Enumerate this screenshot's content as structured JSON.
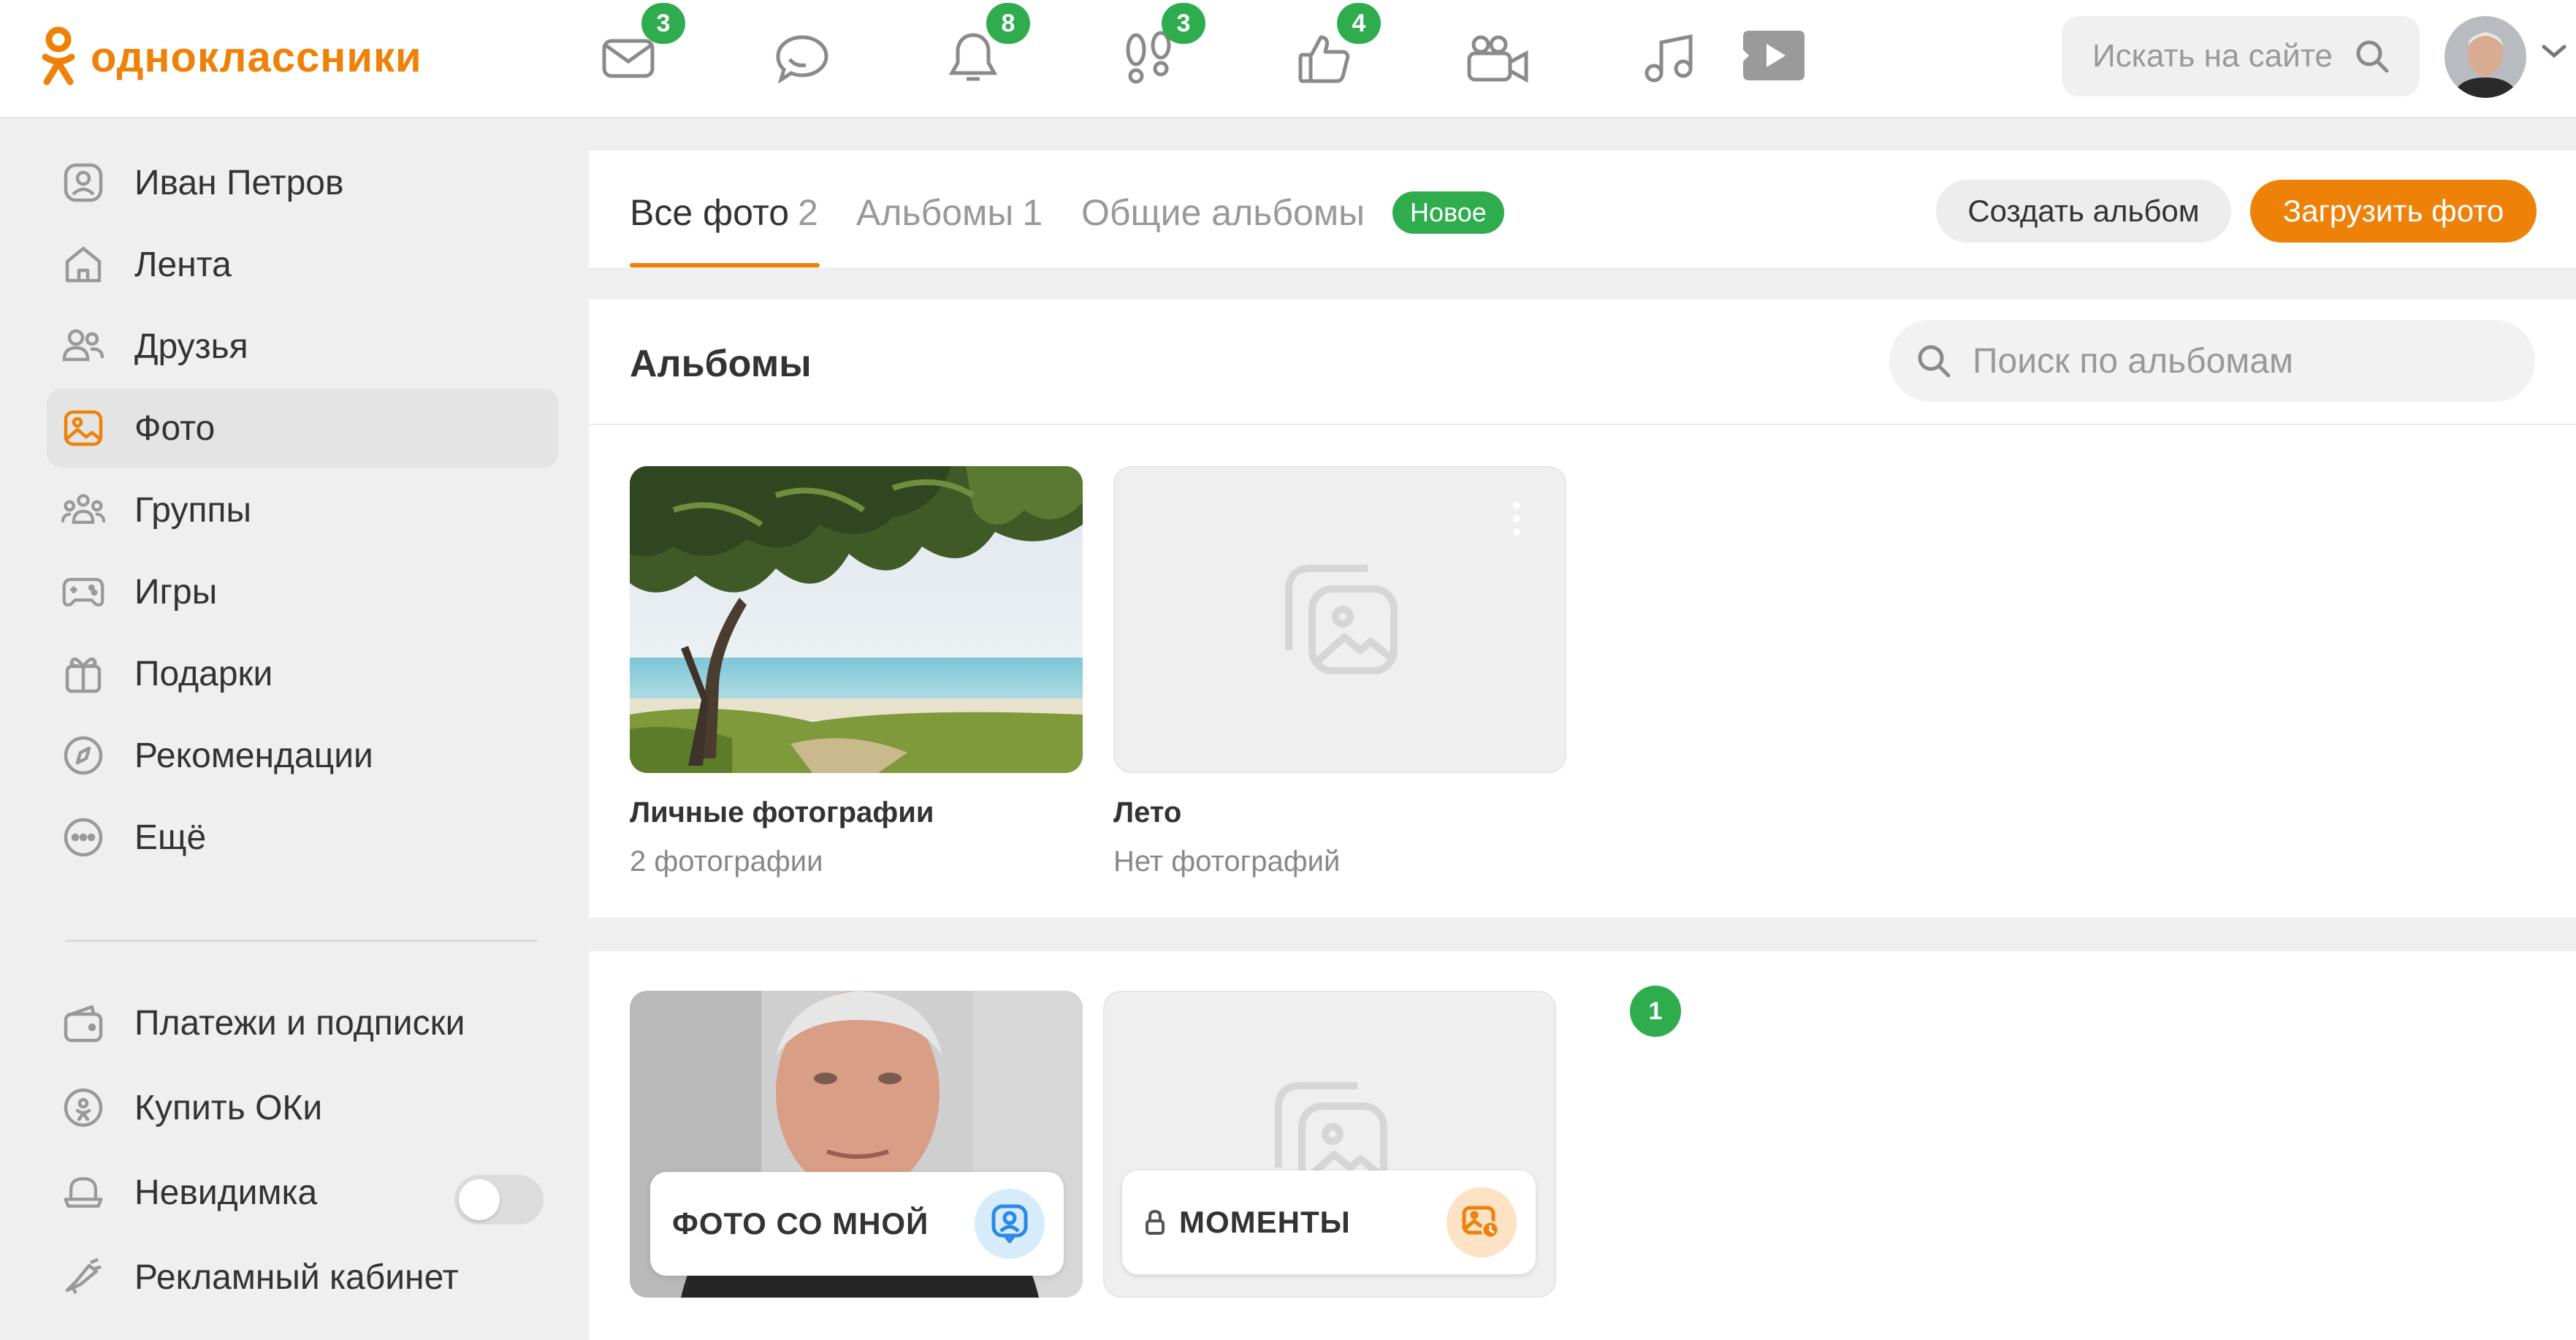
{
  "header": {
    "logo_text": "одноклассники",
    "nav": [
      {
        "icon": "mail-icon",
        "badge": "3"
      },
      {
        "icon": "chat-icon",
        "badge": ""
      },
      {
        "icon": "bell-icon",
        "badge": "8"
      },
      {
        "icon": "footprints-icon",
        "badge": "3"
      },
      {
        "icon": "like-icon",
        "badge": "4"
      },
      {
        "icon": "video-camera-icon",
        "badge": ""
      },
      {
        "icon": "music-icon",
        "badge": ""
      },
      {
        "icon": "video-play-icon",
        "badge": ""
      }
    ],
    "search_placeholder": "Искать на сайте"
  },
  "sidebar": {
    "items": [
      {
        "label": "Иван Петров",
        "icon": "user-icon"
      },
      {
        "label": "Лента",
        "icon": "home-icon"
      },
      {
        "label": "Друзья",
        "icon": "friends-icon"
      },
      {
        "label": "Фото",
        "icon": "photo-icon",
        "active": true
      },
      {
        "label": "Группы",
        "icon": "groups-icon"
      },
      {
        "label": "Игры",
        "icon": "gamepad-icon"
      },
      {
        "label": "Подарки",
        "icon": "gift-icon"
      },
      {
        "label": "Рекомендации",
        "icon": "compass-icon"
      },
      {
        "label": "Ещё",
        "icon": "more-icon"
      }
    ],
    "bottom_items": [
      {
        "label": "Платежи и подписки",
        "icon": "wallet-icon"
      },
      {
        "label": "Купить ОКи",
        "icon": "ok-coin-icon"
      },
      {
        "label": "Невидимка",
        "icon": "invisible-icon",
        "toggle": false
      },
      {
        "label": "Рекламный кабинет",
        "icon": "megaphone-icon"
      }
    ]
  },
  "tabs": {
    "all_photos_label": "Все фото",
    "all_photos_count": "2",
    "albums_label": "Альбомы",
    "albums_count": "1",
    "shared_label": "Общие альбомы",
    "new_badge": "Новое",
    "create_album": "Создать альбом",
    "upload_photo": "Загрузить фото"
  },
  "albums": {
    "title": "Альбомы",
    "search_placeholder": "Поиск по альбомам",
    "items": [
      {
        "name": "Личные фотографии",
        "count": "2 фотографии"
      },
      {
        "name": "Лето",
        "count": "Нет фотографий"
      }
    ]
  },
  "special": {
    "photos_with_me": "ФОТО СО МНОЙ",
    "photos_with_me_badge": "1",
    "moments": "МОМЕНТЫ"
  },
  "colors": {
    "accent": "#ee8208",
    "badge_green": "#2fad4e"
  }
}
